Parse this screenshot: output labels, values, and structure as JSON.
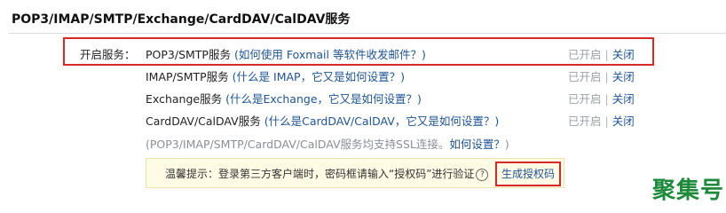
{
  "title": "POP3/IMAP/SMTP/Exchange/CardDAV/CalDAV服务",
  "services_label": "开启服务：",
  "services": [
    {
      "name": "POP3/SMTP服务",
      "help": "(如何使用 Foxmail 等软件收发邮件？)",
      "status": "已开启",
      "action": "关闭"
    },
    {
      "name": "IMAP/SMTP服务",
      "help": "(什么是 IMAP，它又是如何设置？)",
      "status": "已开启",
      "action": "关闭"
    },
    {
      "name": "Exchange服务",
      "help": "(什么是Exchange，它又是如何设置？)",
      "status": "已开启",
      "action": "关闭"
    },
    {
      "name": "CardDAV/CalDAV服务",
      "help": "(什么是CardDAV/CalDAV，它又是如何设置？)",
      "status": "已开启",
      "action": "关闭"
    }
  ],
  "ssl_note": {
    "prefix": "(POP3/IMAP/SMTP/CardDAV/CalDAV服务均支持SSL连接。",
    "link": "如何设置？",
    "suffix": ")"
  },
  "tip": {
    "text": "温馨提示：登录第三方客户端时，密码框请输入“授权码”进行验证",
    "help_icon": "?",
    "button": "生成授权码"
  },
  "watermark": "聚集号",
  "colors": {
    "accent": "#1e5494",
    "highlight": "#d82828",
    "tip_bg": "#fffbe5",
    "watermark": "#1c8a3a"
  }
}
